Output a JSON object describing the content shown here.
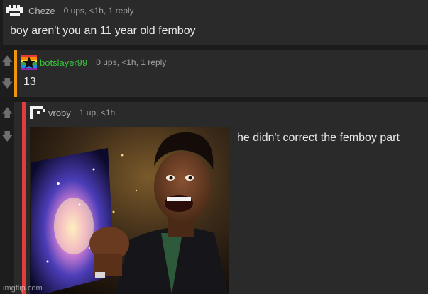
{
  "comments": [
    {
      "username": "Cheze",
      "meta": "0 ups, <1h, 1 reply",
      "text": "boy aren't you an 11 year old femboy",
      "username_color": "#b7b7b7"
    },
    {
      "username": "botslayer99",
      "meta": "0 ups, <1h, 1 reply",
      "text": "13",
      "username_color": "#39c33b",
      "accent_color": "#f0960d"
    },
    {
      "username": "vroby",
      "meta": "1 up, <1h",
      "text": "he didn't correct the femboy part",
      "username_color": "#b7b7b7",
      "accent_color": "#e23b3b",
      "image_icon": "amazed-man-holding-galaxy-image"
    }
  ],
  "watermark": "imgflip.com",
  "icons": {
    "upvote": "arrow-up-icon",
    "downvote": "arrow-down-icon"
  }
}
